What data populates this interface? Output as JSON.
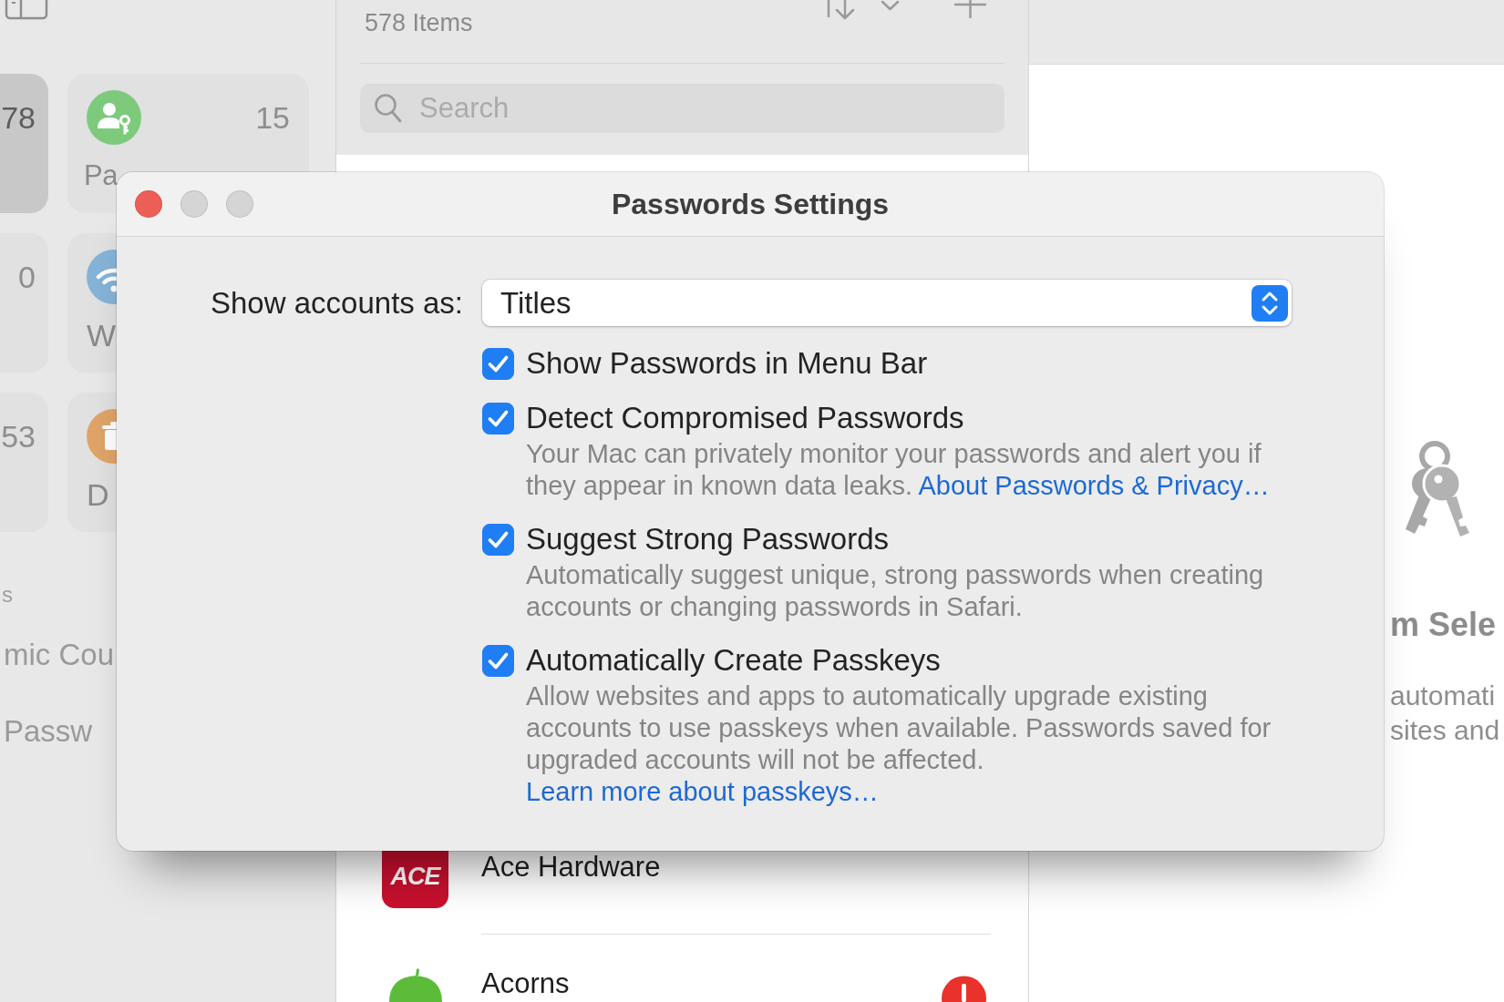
{
  "sidebar": {
    "tiles": [
      {
        "kind": "plain",
        "count": "78",
        "selected": true
      },
      {
        "kind": "passkey",
        "color": "#7dca7d",
        "count": "15",
        "label": "Pa",
        "selected": false
      },
      {
        "kind": "plain",
        "count": "0",
        "selected": false
      },
      {
        "kind": "wifi",
        "color": "#86b4d8",
        "label": "W",
        "selected": false
      },
      {
        "kind": "plain",
        "count": "53",
        "selected": false
      },
      {
        "kind": "trash",
        "color": "#e0a468",
        "label": "D",
        "selected": false
      }
    ],
    "section_heading": "s",
    "items": [
      {
        "label": "mic Cou"
      },
      {
        "label": "Passw"
      }
    ]
  },
  "list": {
    "count": "578 Items",
    "search": {
      "placeholder": "Search"
    },
    "rows": [
      {
        "kind": "ace",
        "logo_text": "ACE",
        "title": "Ace Hardware",
        "warning": false
      },
      {
        "kind": "acorn",
        "title": "Acorns",
        "warning": true
      }
    ]
  },
  "detail": {
    "title": "m Sele",
    "description_lines": [
      "automati",
      "sites and"
    ]
  },
  "dialog": {
    "window_controls": [
      {
        "kind": "close",
        "enabled": true
      },
      {
        "kind": "minimize",
        "enabled": false
      },
      {
        "kind": "zoom",
        "enabled": false
      }
    ],
    "title": "Passwords Settings",
    "accounts": {
      "label": "Show accounts as:",
      "value": "Titles"
    },
    "options": [
      {
        "label": "Show Passwords in Menu Bar",
        "checked": true
      },
      {
        "label": "Detect Compromised Passwords",
        "checked": true,
        "description": "Your Mac can privately monitor your passwords and alert you if they appear in known data leaks.",
        "link": "About Passwords & Privacy…"
      },
      {
        "label": "Suggest Strong Passwords",
        "checked": true,
        "description": "Automatically suggest unique, strong passwords when creating accounts or changing passwords in Safari."
      },
      {
        "label": "Automatically Create Passkeys",
        "checked": true,
        "description": "Allow websites and apps to automatically upgrade existing accounts to use passkeys when available. Passwords saved for upgraded accounts will not be affected.",
        "link": "Learn more about passkeys…"
      }
    ]
  }
}
